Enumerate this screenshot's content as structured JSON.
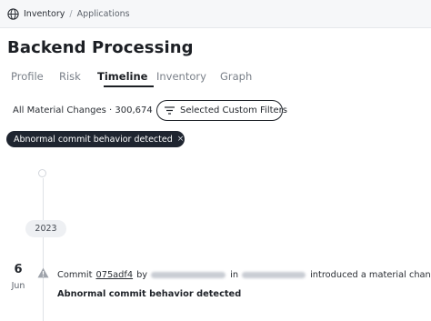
{
  "breadcrumb": {
    "root_icon": "globe-icon",
    "items": [
      "Inventory",
      "Applications"
    ],
    "separator": "/"
  },
  "page": {
    "title": "Backend Processing"
  },
  "tabs": [
    {
      "label": "Profile",
      "active": false
    },
    {
      "label": "Risk",
      "active": false
    },
    {
      "label": "Timeline",
      "active": true
    },
    {
      "label": "Inventory",
      "active": false
    },
    {
      "label": "Graph",
      "active": false
    }
  ],
  "toolbar": {
    "changes_label": "All Material Changes · 300,674",
    "filters_icon": "filter-lines-icon",
    "filters_label": "Selected Custom Filters"
  },
  "chip": {
    "label": "Abnormal commit behavior detected",
    "close": "×"
  },
  "timeline": {
    "year": "2023",
    "event": {
      "day": "6",
      "month": "Jun",
      "icon": "warning-triangle-icon",
      "prefix": "Commit",
      "commit": "075adf4",
      "by": "by",
      "in": "in",
      "suffix": "introduced a material change",
      "description": "Abnormal commit behavior detected"
    }
  },
  "colors": {
    "chip_bg": "#1f2530",
    "active_tab": "#1c1f24",
    "inactive_tab": "#7a8089",
    "topbar_bg": "#f6f7f9",
    "year_pill_bg": "#eef0f3",
    "timeline_line": "#dfe2e7",
    "warning_icon": "#9ea3ab"
  }
}
